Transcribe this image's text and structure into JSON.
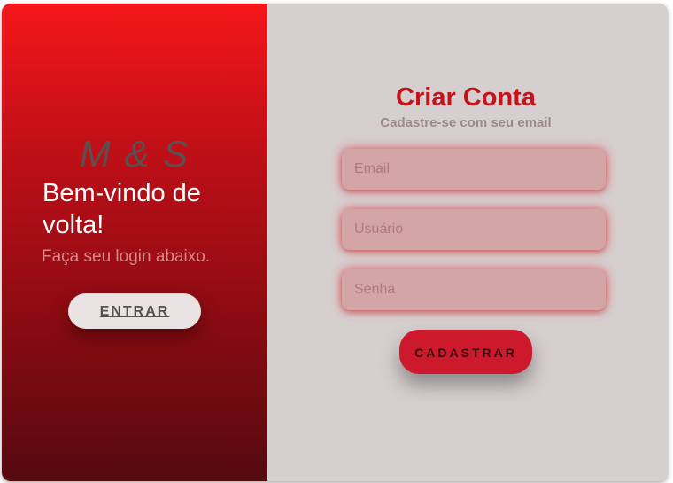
{
  "left_panel": {
    "logo": "M & S",
    "welcome_title": "Bem-vindo de volta!",
    "welcome_subtitle": "Faça seu login abaixo.",
    "enter_button": "ENTRAR"
  },
  "right_panel": {
    "title": "Criar Conta",
    "subtitle": "Cadastre-se com seu email",
    "fields": [
      {
        "placeholder": "Email",
        "value": ""
      },
      {
        "placeholder": "Usuário",
        "value": ""
      },
      {
        "placeholder": "Senha",
        "value": ""
      }
    ],
    "submit_button": "CADASTRAR"
  },
  "colors": {
    "accent": "#c3141b",
    "left_gradient_top": "#f4171a",
    "left_gradient_bottom": "#540910",
    "background": "#d6cfd0",
    "field_bg": "#d3a5a7",
    "submit_bg": "#cc1a2c"
  }
}
